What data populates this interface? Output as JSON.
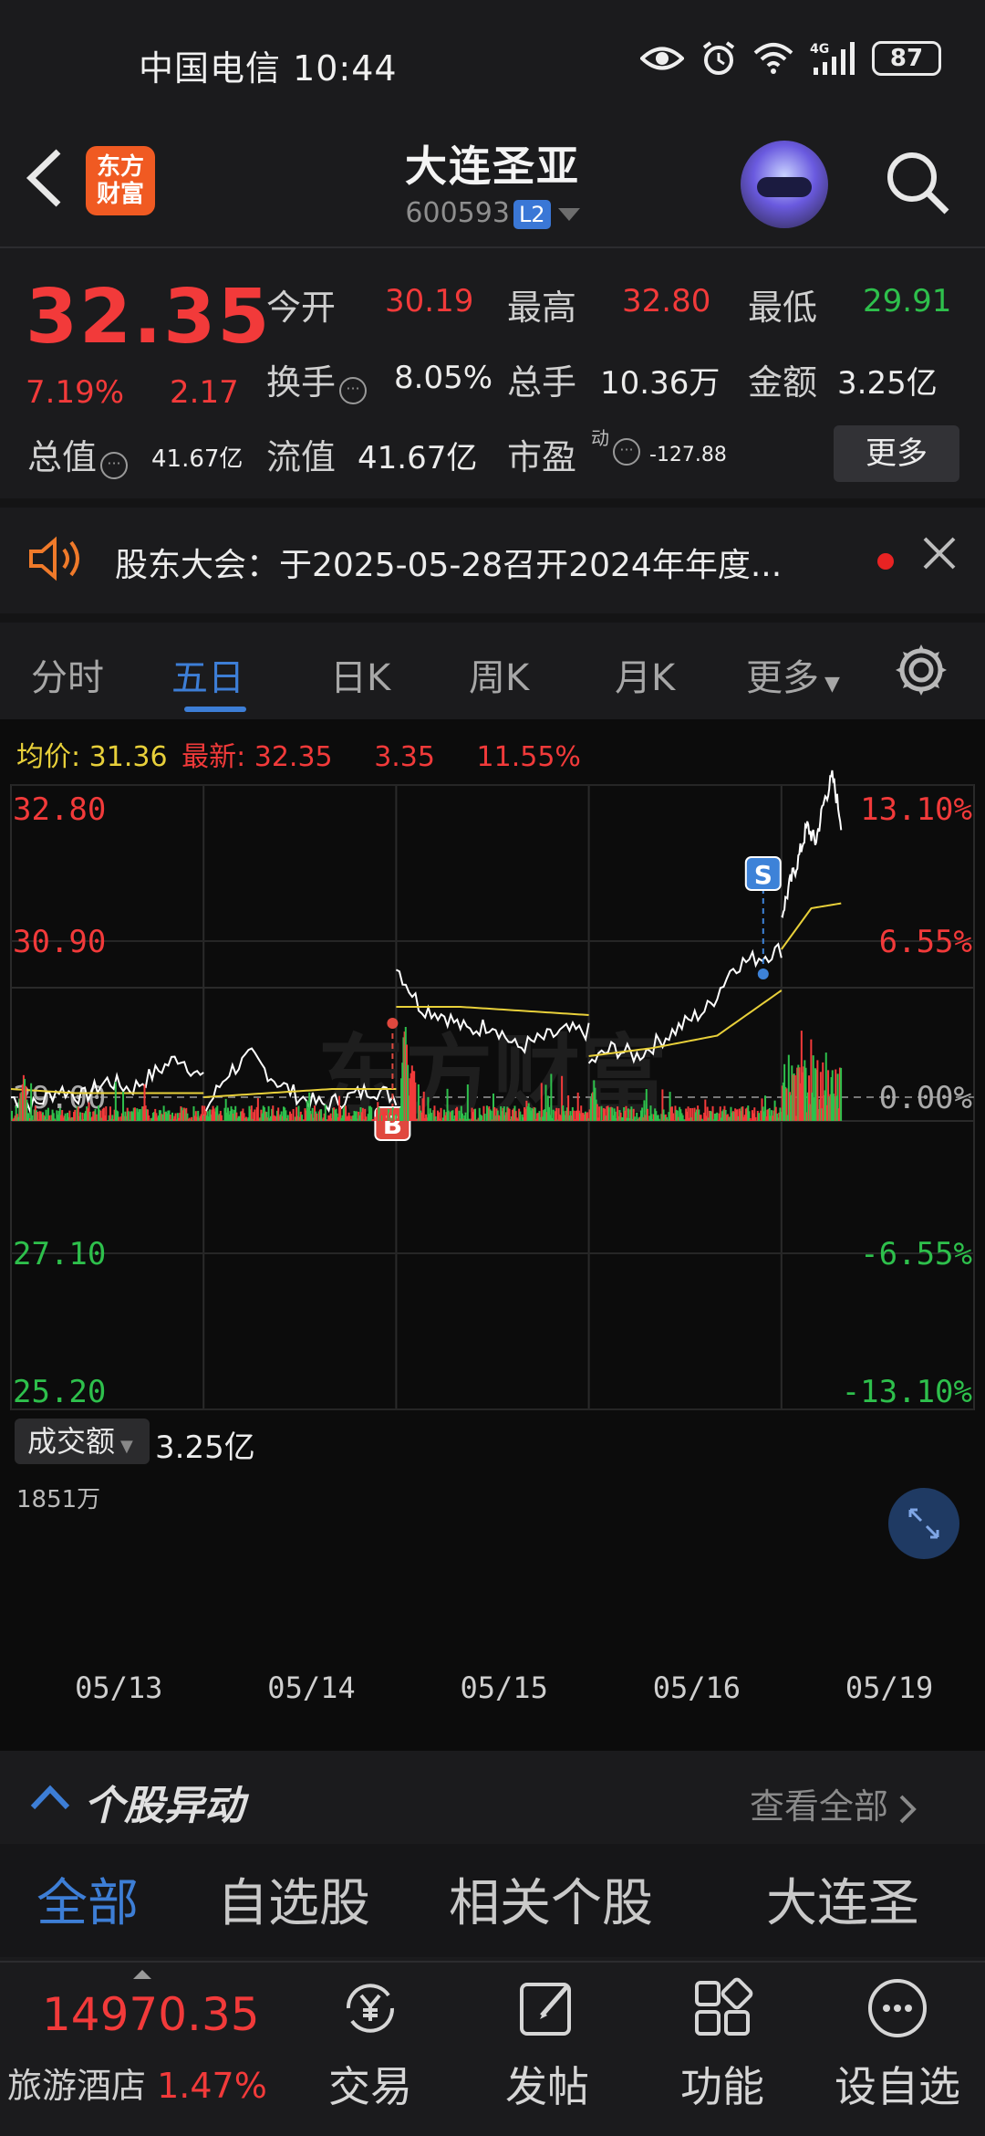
{
  "status_bar": {
    "carrier_time": "中国电信 10:44",
    "battery": "87",
    "network": "4G"
  },
  "header": {
    "stock_name": "大连圣亚",
    "stock_code": "600593",
    "level_badge": "L2",
    "logo_text": "东方\n财富",
    "logo_line1": "东方",
    "logo_line2": "财富"
  },
  "quote": {
    "price": "32.35",
    "change_pct": "7.19%",
    "change": "2.17",
    "open_label": "今开",
    "open": "30.19",
    "high_label": "最高",
    "high": "32.80",
    "low_label": "最低",
    "low": "29.91",
    "turnover_label": "换手",
    "turnover": "8.05%",
    "volume_label": "总手",
    "volume": "10.36万",
    "amount_label": "金额",
    "amount": "3.25亿",
    "mktcap_label": "总值",
    "mktcap": "41.67亿",
    "float_label": "流值",
    "float_value": "41.67亿",
    "pe_label": "市盈",
    "pe_super": "动",
    "pe": "-127.88",
    "more_button": "更多"
  },
  "notice": {
    "text": "股东大会：于2025-05-28召开2024年年度..."
  },
  "tabs": [
    {
      "label": "分时"
    },
    {
      "label": "五日"
    },
    {
      "label": "日K"
    },
    {
      "label": "周K"
    },
    {
      "label": "月K"
    },
    {
      "label": "更多"
    }
  ],
  "chart_info": {
    "avg_label": "均价:",
    "avg_value": "31.36",
    "latest_label": "最新:",
    "latest_value": "32.35",
    "latest_change": "3.35",
    "latest_pct": "11.55%",
    "volume_selector": "成交额",
    "volume_total": "3.25亿",
    "volume_max_label": "1851万",
    "buy_marker": "B",
    "sell_marker": "S",
    "watermark": "东方财富"
  },
  "chart_data": {
    "type": "line",
    "title": "",
    "x": [
      "05/13",
      "05/14",
      "05/15",
      "05/16",
      "05/19"
    ],
    "y_left_ticks": [
      "32.80",
      "30.90",
      "29.00",
      "27.10",
      "25.20"
    ],
    "y_right_ticks": [
      "13.10%",
      "6.55%",
      "0.00%",
      "-6.55%",
      "-13.10%"
    ],
    "ylim": [
      25.2,
      32.8
    ],
    "baseline": 29.0,
    "series": [
      {
        "name": "",
        "color": "#ffffff",
        "values_per_day": [
          [
            29.0,
            28.9,
            29.1,
            29.0,
            29.2,
            29.1,
            29.3,
            29.5,
            29.2
          ],
          [
            28.8,
            29.3,
            29.5,
            29.2,
            29.0,
            28.9,
            29.0,
            29.1,
            29.0
          ],
          [
            30.6,
            30.1,
            30.0,
            29.8,
            29.9,
            29.6,
            29.7,
            29.8,
            29.8
          ],
          [
            29.4,
            29.6,
            29.5,
            29.7,
            29.9,
            30.1,
            30.6,
            30.7,
            30.8
          ],
          [
            31.2,
            31.6,
            31.9,
            32.3,
            32.1,
            32.6,
            32.9,
            32.35
          ]
        ]
      },
      {
        "name": "均价",
        "color": "#e8d03a",
        "values_per_day": [
          [
            29.1,
            29.05,
            29.05,
            29.05
          ],
          [
            29.0,
            29.05,
            29.1,
            29.1
          ],
          [
            30.1,
            30.1,
            30.05,
            30.0
          ],
          [
            29.5,
            29.6,
            29.75,
            30.3
          ],
          [
            30.8,
            31.3,
            31.36
          ]
        ]
      }
    ],
    "volume": {
      "max": "1851万",
      "total": "3.25亿"
    },
    "markers": [
      {
        "label": "B",
        "day": "05/15",
        "price": 29.9
      },
      {
        "label": "S",
        "day": "05/16",
        "price": 30.5
      }
    ]
  },
  "movement": {
    "title": "个股异动",
    "view_all": "查看全部"
  },
  "categories": [
    {
      "label": "全部"
    },
    {
      "label": "自选股"
    },
    {
      "label": "相关个股"
    },
    {
      "label": "大连圣"
    }
  ],
  "bottom_nav": {
    "index_value": "14970.35",
    "index_name": "旅游酒店",
    "index_pct": "1.47%",
    "items": [
      {
        "label": "交易",
        "icon": "yuan-exchange-icon"
      },
      {
        "label": "发帖",
        "icon": "edit-icon"
      },
      {
        "label": "功能",
        "icon": "grid-icon"
      },
      {
        "label": "设自选",
        "icon": "more-icon"
      }
    ]
  }
}
